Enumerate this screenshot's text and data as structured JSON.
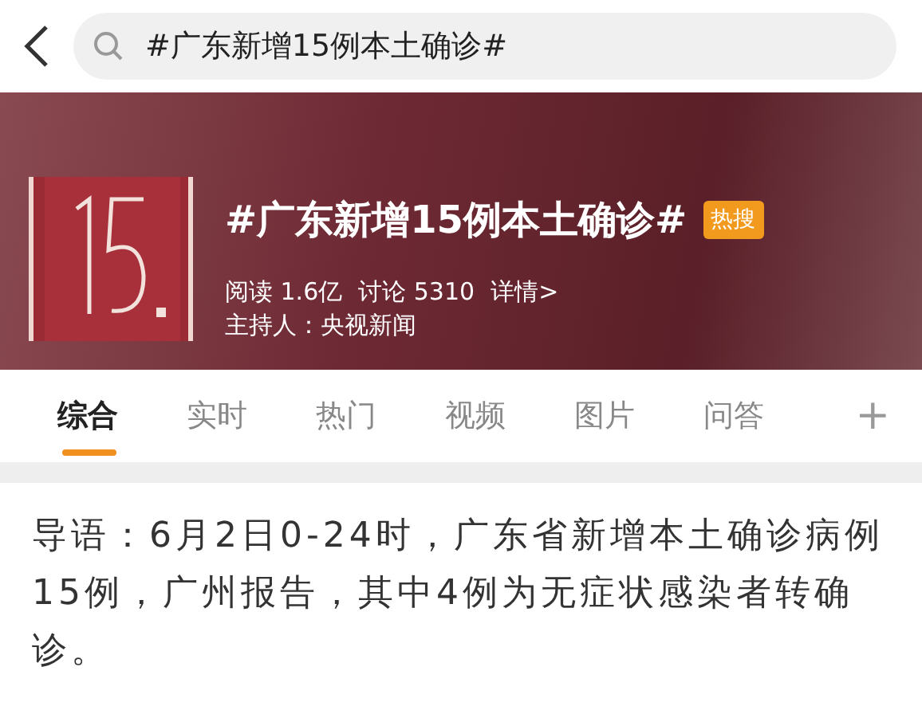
{
  "search": {
    "value": "#广东新增15例本土确诊#"
  },
  "topic": {
    "title": "#广东新增15例本土确诊#",
    "badge": "热搜",
    "reads": "阅读 1.6亿",
    "discussions": "讨论 5310",
    "details": "详情>",
    "host": "主持人：央视新闻"
  },
  "tabs": [
    {
      "label": "综合",
      "selected": true
    },
    {
      "label": "实时",
      "selected": false
    },
    {
      "label": "热门",
      "selected": false
    },
    {
      "label": "视频",
      "selected": false
    },
    {
      "label": "图片",
      "selected": false
    },
    {
      "label": "问答",
      "selected": false
    }
  ],
  "add_tab": "+",
  "intro": "导语：6月2日0-24时，广东省新增本土确诊病例15例，广州报告，其中4例为无症状感染者转确诊。"
}
